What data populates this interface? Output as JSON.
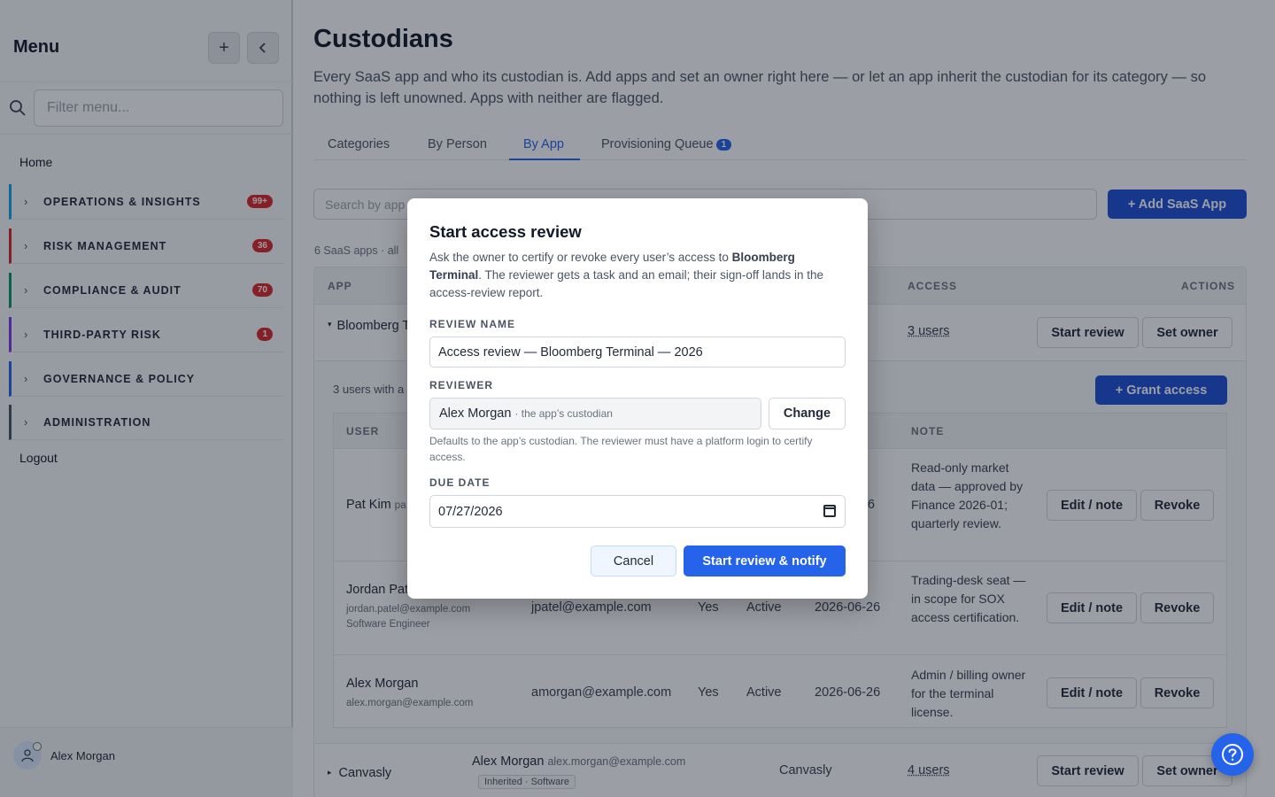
{
  "sidebar": {
    "title": "Menu",
    "add_icon": "plus-icon",
    "collapse_icon": "chevron-left-icon",
    "filter_placeholder": "Filter menu...",
    "home": "Home",
    "items": [
      {
        "label": "OPERATIONS & INSIGHTS",
        "badge": "99+",
        "color": "#0ea5e9"
      },
      {
        "label": "RISK MANAGEMENT",
        "badge": "36",
        "color": "#dc2626"
      },
      {
        "label": "COMPLIANCE & AUDIT",
        "badge": "70",
        "color": "#059669"
      },
      {
        "label": "THIRD-PARTY RISK",
        "badge": "1",
        "color": "#7c3aed"
      },
      {
        "label": "GOVERNANCE & POLICY",
        "badge": "",
        "color": "#2563eb"
      },
      {
        "label": "ADMINISTRATION",
        "badge": "",
        "color": "#4b5563"
      }
    ],
    "logout": "Logout",
    "user_name": "Alex Morgan"
  },
  "main": {
    "title": "Custodians",
    "description": "Every SaaS app and who its custodian is. Add apps and set an owner right here — or let an app inherit the custodian for its category — so nothing is left unowned. Apps with neither are flagged.",
    "tabs": [
      {
        "label": "Categories"
      },
      {
        "label": "By Person"
      },
      {
        "label": "By App",
        "active": true
      },
      {
        "label": "Provisioning Queue",
        "count": "1"
      }
    ],
    "search_placeholder": "Search by app",
    "add_app_label": "+ Add SaaS App",
    "count_text": "6 SaaS apps · all",
    "headers": {
      "app": "APP",
      "access": "ACCESS",
      "actions": "ACTIONS"
    },
    "apps": [
      {
        "name": "Bloomberg Terminal",
        "users": "3 users",
        "start_review": "Start review",
        "set_owner": "Set owner"
      },
      {
        "name": "Canvasly",
        "custodian": "Alex Morgan",
        "custodian_email": "alex.morgan@example.com",
        "tag": "Inherited · Software",
        "category": "Canvasly",
        "users": "4 users",
        "start_review": "Start review",
        "set_owner": "Set owner"
      }
    ],
    "sub": {
      "count_text": "3 users with a",
      "grant_label": "+ Grant access",
      "headers": {
        "user": "USER",
        "note": "NOTE"
      },
      "rows": [
        {
          "name": "Pat Kim",
          "name_suffix": "pa",
          "date_tail": "-26",
          "note": "Read-only market data — approved by Finance 2026-01; quarterly review.",
          "edit": "Edit / note",
          "revoke": "Revoke"
        },
        {
          "name": "Jordan Pat",
          "email": "jordan.patel@example.com",
          "title": "Software Engineer",
          "login": "jpatel@example.com",
          "mfa": "Yes",
          "status": "Active",
          "date": "2026-06-26",
          "note": "Trading-desk seat — in scope for SOX access certification.",
          "edit": "Edit / note",
          "revoke": "Revoke"
        },
        {
          "name": "Alex Morgan",
          "email": "alex.morgan@example.com",
          "login": "amorgan@example.com",
          "mfa": "Yes",
          "status": "Active",
          "date": "2026-06-26",
          "note": "Admin / billing owner for the terminal license.",
          "edit": "Edit / note",
          "revoke": "Revoke"
        }
      ]
    }
  },
  "modal": {
    "title": "Start access review",
    "desc_prefix": "Ask the owner to certify or revoke every user’s access to ",
    "desc_app": "Bloomberg Terminal",
    "desc_suffix": ". The reviewer gets a task and an email; their sign-off lands in the access-review report.",
    "review_name_label": "REVIEW NAME",
    "review_name_value": "Access review — Bloomberg Terminal — 2026",
    "reviewer_label": "REVIEWER",
    "reviewer_name": "Alex Morgan",
    "reviewer_hint": "· the app’s custodian",
    "change_label": "Change",
    "reviewer_help": "Defaults to the app’s custodian. The reviewer must have a platform login to certify access.",
    "due_date_label": "DUE DATE",
    "due_date_value": "07/27/2026",
    "cancel_label": "Cancel",
    "submit_label": "Start review & notify"
  },
  "help_icon": "question-circle-icon",
  "colors": {
    "accent": "#2563eb",
    "badge": "#dc2626"
  }
}
